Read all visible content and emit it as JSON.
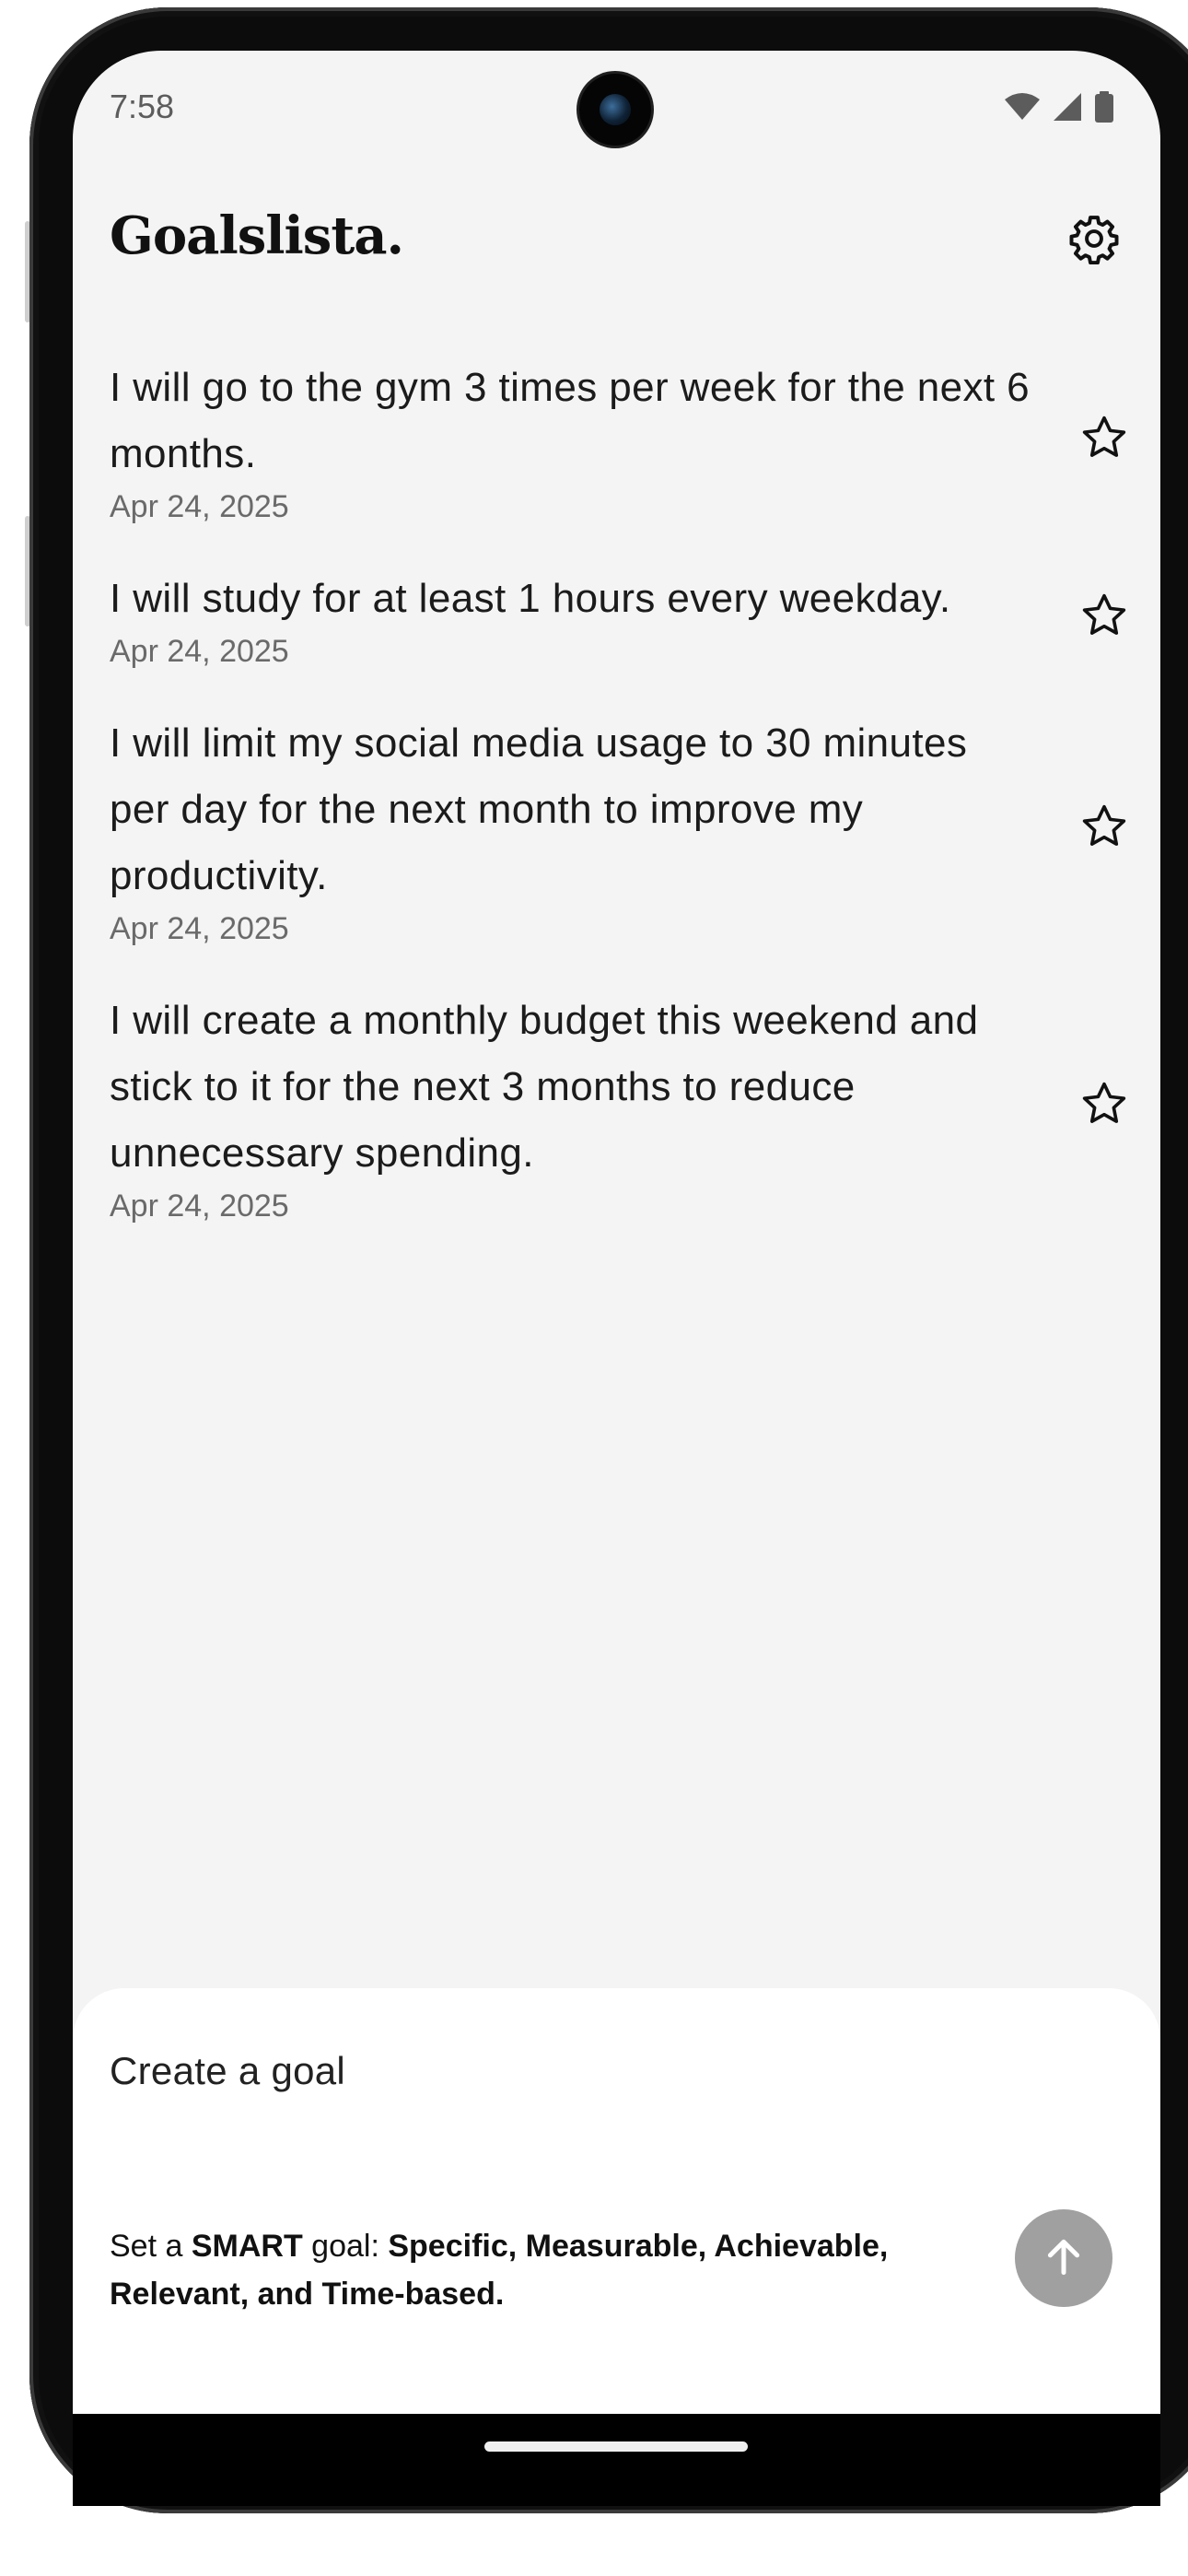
{
  "status_bar": {
    "time": "7:58",
    "icons": [
      "wifi-icon",
      "cellular-signal-icon",
      "battery-icon"
    ]
  },
  "header": {
    "title": "Goalslista.",
    "settings_icon": "gear-icon"
  },
  "goals": [
    {
      "text": "I will go to the gym 3 times per week for the next 6 months.",
      "date": "Apr 24, 2025",
      "starred": false
    },
    {
      "text": "I will study for at least 1 hours every weekday.",
      "date": "Apr 24, 2025",
      "starred": false
    },
    {
      "text": "I will limit my social media usage to 30 minutes per day for the next month to improve my productivity.",
      "date": "Apr 24, 2025",
      "starred": false
    },
    {
      "text": "I will create a monthly budget this weekend and stick to it for the next 3 months to reduce unnecessary spending.",
      "date": "Apr 24, 2025",
      "starred": false
    }
  ],
  "composer": {
    "placeholder": "Create a goal",
    "value": "",
    "hint_prefix": "Set a ",
    "hint_smart": "SMART",
    "hint_middle": " goal: ",
    "hint_criteria": "Specific, Measurable, Achievable, Relevant, and Time-based.",
    "send_icon": "arrow-up-icon"
  },
  "colors": {
    "background": "#f4f4f4",
    "card": "#ffffff",
    "send_button": "#a0a0a0",
    "text": "#1b1b1b",
    "date_text": "#6a6a6a"
  }
}
